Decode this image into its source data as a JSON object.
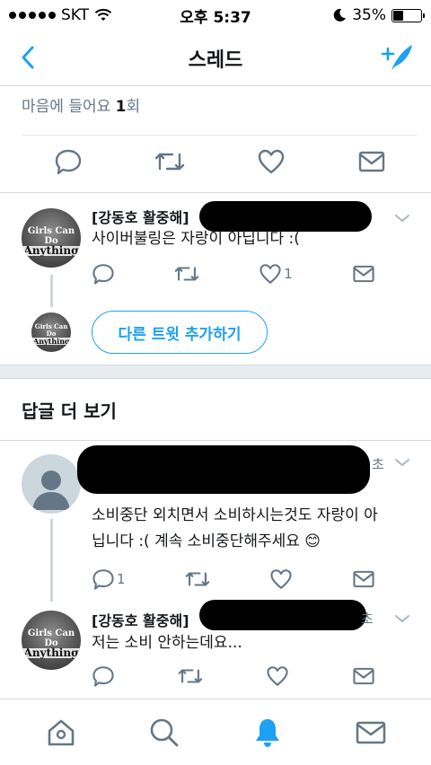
{
  "status_bar": {
    "carrier": "SKT",
    "time": "오후 5:37",
    "battery": "35%",
    "battery_level": 0.35
  },
  "nav": {
    "title": "스레드"
  },
  "main_tweet_stats": {
    "like_label": "마음에 들어요",
    "like_count": "1",
    "like_unit": "회"
  },
  "tweets": [
    {
      "name": "[강동호 활중해]",
      "text": "사이버불링은 자랑이 아닙니다 :(",
      "like_count": "1",
      "avatar_text_1": "Girls Can Do",
      "avatar_text_2": "Anything"
    }
  ],
  "add_tweet": {
    "label": "다른 트윗 추가하기"
  },
  "more_replies": {
    "title": "답글 더 보기"
  },
  "replies": [
    {
      "time_partial": "초",
      "text_line1": "소비중단 외치면서 소비하시는것도 자랑이 아",
      "text_line2": "닙니다 :( 계속 소비중단해주세요 😊",
      "reply_count": "1"
    },
    {
      "name": "[강동호 활중해]",
      "time_partial": "초",
      "text": "저는 소비 안하는데요..."
    }
  ],
  "icons": {
    "back": "chevron-left-icon",
    "compose": "compose-icon",
    "reply": "reply-icon",
    "retweet": "retweet-icon",
    "like": "heart-icon",
    "dm": "envelope-icon",
    "home": "home-icon",
    "search": "search-icon",
    "notifications": "bell-icon",
    "messages": "envelope-icon"
  },
  "colors": {
    "accent": "#1da1f2",
    "text": "#14171a",
    "secondary": "#657786",
    "divider": "#e1e8ed"
  }
}
